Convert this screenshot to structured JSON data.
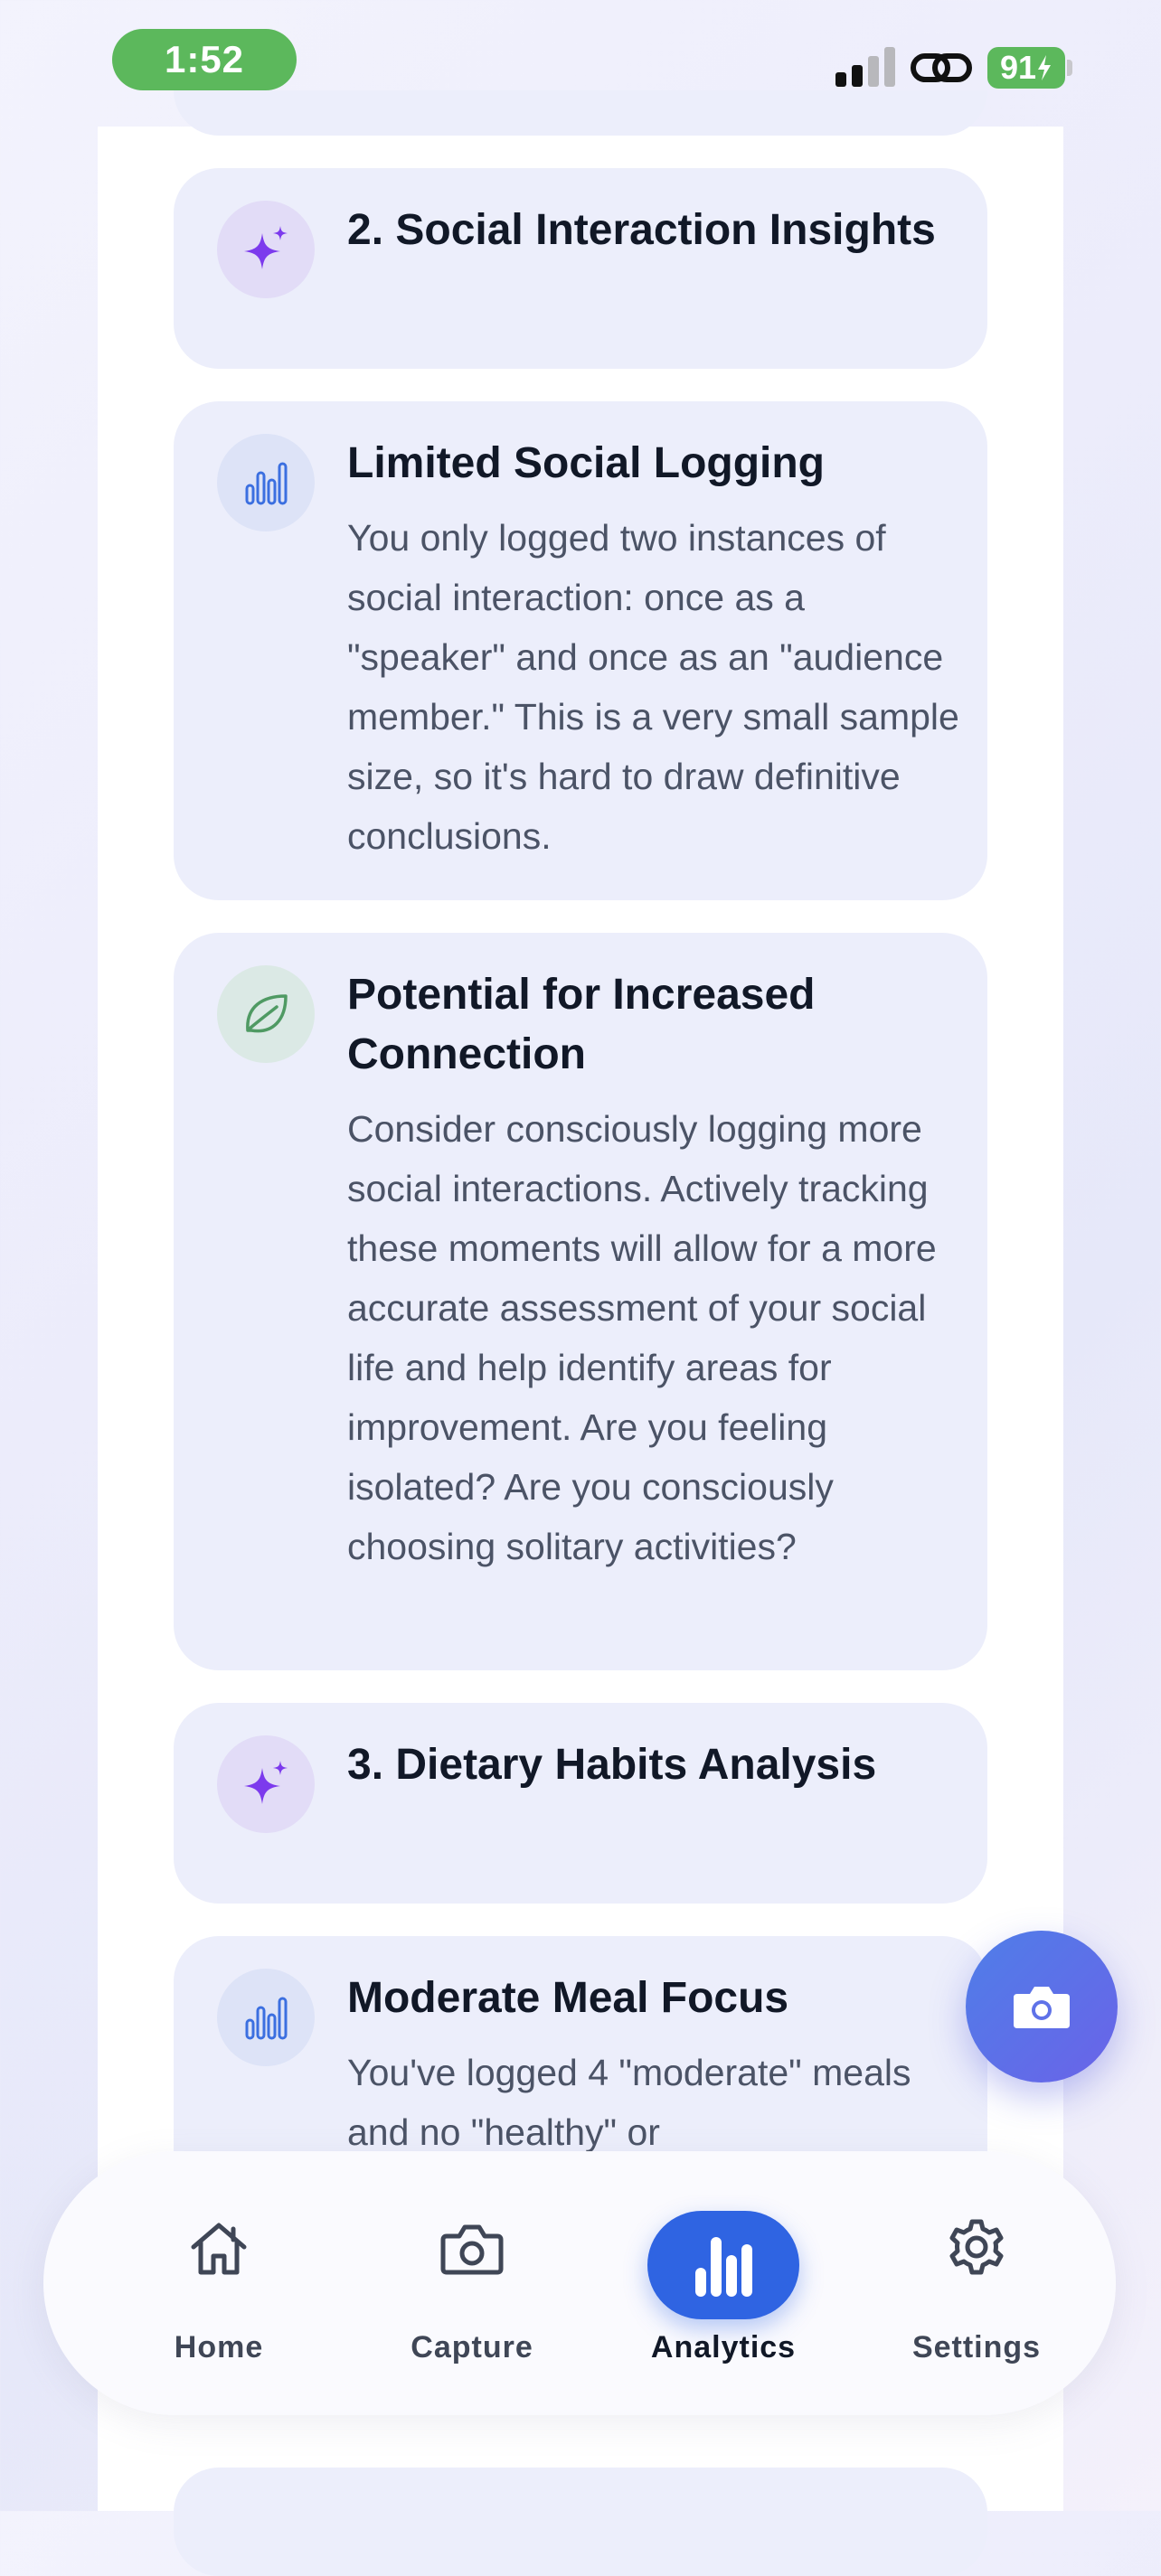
{
  "status_bar": {
    "time": "1:52",
    "battery": "91"
  },
  "cards": [
    {
      "icon": "sparkles-icon",
      "title": "2. Social Interaction Insights",
      "body": ""
    },
    {
      "icon": "bar-chart-icon",
      "title": "Limited Social Logging",
      "body": "You only logged two instances of social interaction: once as a \"speaker\" and once as an \"audience member.\" This is a very small sample size, so it's hard to draw definitive conclusions."
    },
    {
      "icon": "leaf-icon",
      "title": "Potential for Increased Connection",
      "body": "Consider consciously logging more social interactions. Actively tracking these moments will allow for a more accurate assessment of your social life and help identify areas for improvement. Are you feeling isolated? Are you consciously choosing solitary activities?"
    },
    {
      "icon": "sparkles-icon",
      "title": "3. Dietary Habits Analysis",
      "body": ""
    },
    {
      "icon": "bar-chart-icon",
      "title": "Moderate Meal Focus",
      "body": "You've logged 4 \"moderate\" meals and no \"healthy\" or"
    }
  ],
  "fab": {
    "icon": "camera-icon"
  },
  "nav": {
    "home": "Home",
    "capture": "Capture",
    "analytics": "Analytics",
    "settings": "Settings",
    "active": "analytics"
  },
  "colors": {
    "accent": "#2f64e2",
    "status_green": "#5cb85c",
    "card_bg": "#eceefb",
    "sparkle_purple": "#7c3aed",
    "chart_blue": "#3b6fe0",
    "leaf_green": "#4f9a63"
  }
}
